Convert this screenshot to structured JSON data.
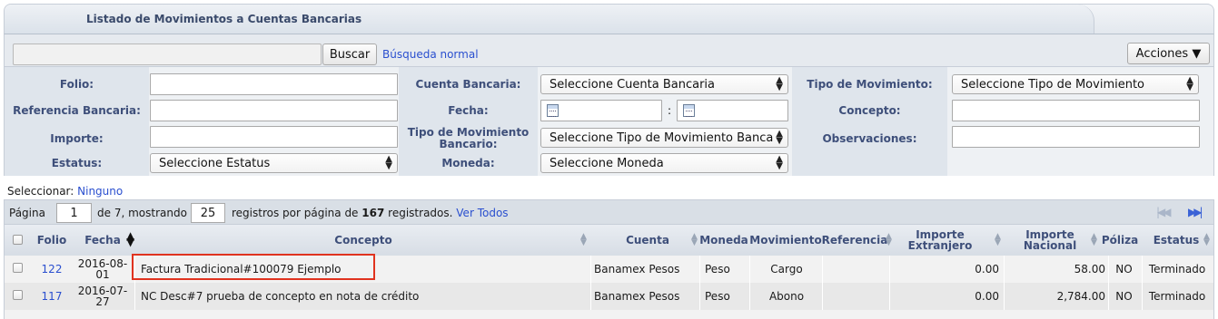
{
  "header": {
    "title": "Listado de Movimientos a Cuentas Bancarias"
  },
  "search": {
    "button": "Buscar",
    "mode_link": "Búsqueda normal",
    "actions": "Acciones ▼"
  },
  "filters": {
    "folio": "Folio:",
    "cuenta_bancaria": "Cuenta Bancaria:",
    "cuenta_bancaria_select": "Seleccione Cuenta Bancaria",
    "tipo_movimiento": "Tipo de Movimiento:",
    "tipo_movimiento_select": "Seleccione Tipo de Movimiento",
    "referencia_bancaria": "Referencia Bancaria:",
    "fecha": "Fecha:",
    "fecha_sep": ":",
    "concepto": "Concepto:",
    "importe": "Importe:",
    "tipo_mov_bancario_l1": "Tipo de Movimiento",
    "tipo_mov_bancario_l2": "Bancario:",
    "tipo_mov_bancario_select": "Seleccione Tipo de Movimiento Banca",
    "observaciones": "Observaciones:",
    "estatus": "Estatus:",
    "estatus_select": "Seleccione Estatus",
    "moneda": "Moneda:",
    "moneda_select": "Seleccione Moneda"
  },
  "selection": {
    "label": "Seleccionar:",
    "link": "Ninguno"
  },
  "pager": {
    "page_label": "Página",
    "page": "1",
    "of_text": "de 7, mostrando",
    "per_page": "25",
    "per_page_text": "registros por página de",
    "total": "167",
    "registered": "registrados.",
    "view_all": "Ver Todos"
  },
  "table": {
    "headers": {
      "folio": "Folio",
      "fecha": "Fecha",
      "concepto": "Concepto",
      "cuenta": "Cuenta",
      "moneda": "Moneda",
      "movimiento": "Movimiento",
      "referencia": "Referencia",
      "importe_ext_l1": "Importe",
      "importe_ext_l2": "Extranjero",
      "importe_nac_l1": "Importe",
      "importe_nac_l2": "Nacional",
      "poliza": "Póliza",
      "estatus": "Estatus"
    },
    "rows": [
      {
        "folio": "122",
        "fecha_l1": "2016-08-",
        "fecha_l2": "01",
        "concepto": "Factura Tradicional#100079 Ejemplo",
        "cuenta": "Banamex Pesos",
        "moneda": "Peso",
        "movimiento": "Cargo",
        "referencia": "",
        "importe_ext": "0.00",
        "importe_nac": "58.00",
        "poliza": "NO",
        "estatus": "Terminado"
      },
      {
        "folio": "117",
        "fecha_l1": "2016-07-",
        "fecha_l2": "27",
        "concepto": "NC Desc#7 prueba de concepto en nota de crédito",
        "cuenta": "Banamex Pesos",
        "moneda": "Peso",
        "movimiento": "Abono",
        "referencia": "",
        "importe_ext": "0.00",
        "importe_nac": "2,784.00",
        "poliza": "NO",
        "estatus": "Terminado"
      }
    ]
  },
  "colors": {
    "label": "#3e4f7a",
    "link": "#2a4fcf",
    "highlight": "#e0331f"
  }
}
